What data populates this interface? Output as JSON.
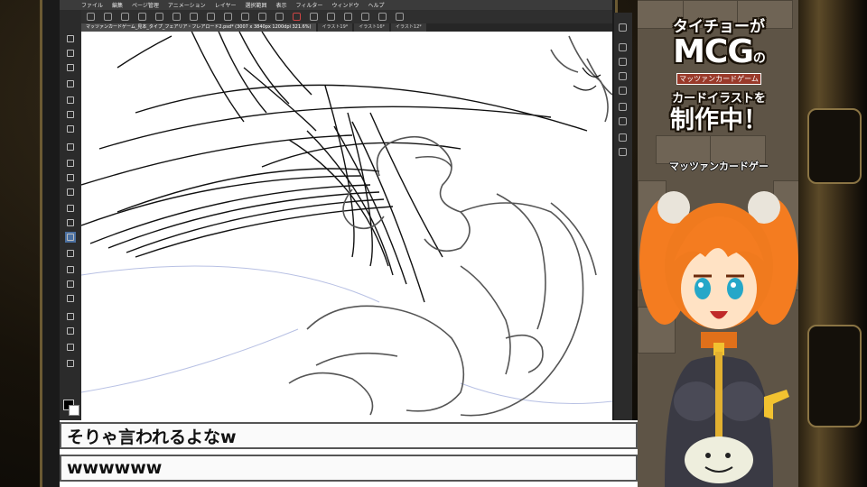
{
  "menu": [
    "ファイル",
    "編集",
    "ページ管理",
    "アニメーション",
    "レイヤー",
    "選択範囲",
    "表示",
    "フィルター",
    "ウィンドウ",
    "ヘルプ"
  ],
  "tabs": [
    {
      "label": "マッツァンカードゲーム_見本_タイプ_フェアリア・フレアロード2.psd* (3007 x 3840px 1200dpi 321.6%)",
      "active": true
    },
    {
      "label": "イラスト19*",
      "active": false
    },
    {
      "label": "イラスト16*",
      "active": false
    },
    {
      "label": "イラスト12*",
      "active": false
    }
  ],
  "chat": {
    "line1": "そりゃ言われるよなw",
    "line2": "wwwwww"
  },
  "banner": {
    "line1": "タイチョーが",
    "mcg": "MCG",
    "mcg_suffix": "の",
    "mcg_caption": "マッツァンカードゲーム",
    "line3": "カードイラストを",
    "line4": "制作中！",
    "subtitle": "マッツァンカードゲー"
  },
  "colors": {
    "accent_orange": "#f07a1e",
    "hair_orange": "#f47c20",
    "selected_tool": "#4a6fa0",
    "panel_bg": "#5e5446"
  },
  "icons": [
    "menu-icon",
    "brush-tool-icon",
    "eraser-icon",
    "fill-icon",
    "selection-icon",
    "zoom-icon",
    "hand-icon",
    "pen-icon",
    "text-icon",
    "undo-icon",
    "redo-icon"
  ]
}
